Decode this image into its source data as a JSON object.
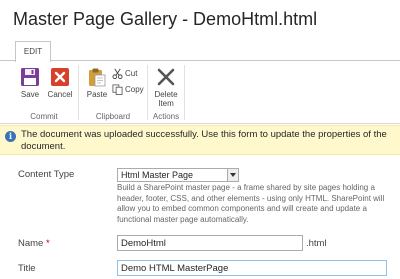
{
  "page": {
    "title": "Master Page Gallery - DemoHtml.html"
  },
  "ribbon": {
    "tab_edit": "EDIT",
    "groups": {
      "commit": {
        "label": "Commit",
        "save": "Save",
        "cancel": "Cancel"
      },
      "clipboard": {
        "label": "Clipboard",
        "paste": "Paste",
        "cut": "Cut",
        "copy": "Copy"
      },
      "actions": {
        "label": "Actions",
        "delete_line1": "Delete",
        "delete_line2": "Item"
      }
    },
    "icons": {
      "save": "floppy-disk-icon",
      "cancel": "cancel-x-icon",
      "paste": "clipboard-paste-icon",
      "cut": "scissors-icon",
      "copy": "copy-icon",
      "delete": "delete-x-icon"
    },
    "colors": {
      "save_purple": "#7a3e97",
      "cancel_red": "#d9402b",
      "paste_gold": "#d39e36"
    }
  },
  "status": {
    "message": "The document was uploaded successfully. Use this form to update the properties of the document.",
    "icon": "info-icon",
    "background": "#fff8cc"
  },
  "form": {
    "content_type": {
      "label": "Content Type",
      "selected": "Html Master Page",
      "description": "Build a SharePoint master page - a frame shared by site pages holding a header, footer, CSS, and other elements - using only HTML. SharePoint will allow you to embed common components and will create and update a functional master page automatically."
    },
    "name": {
      "label": "Name",
      "required_marker": "*",
      "value": "DemoHtml",
      "suffix": ".html"
    },
    "title": {
      "label": "Title",
      "value": "Demo HTML MasterPage"
    }
  }
}
